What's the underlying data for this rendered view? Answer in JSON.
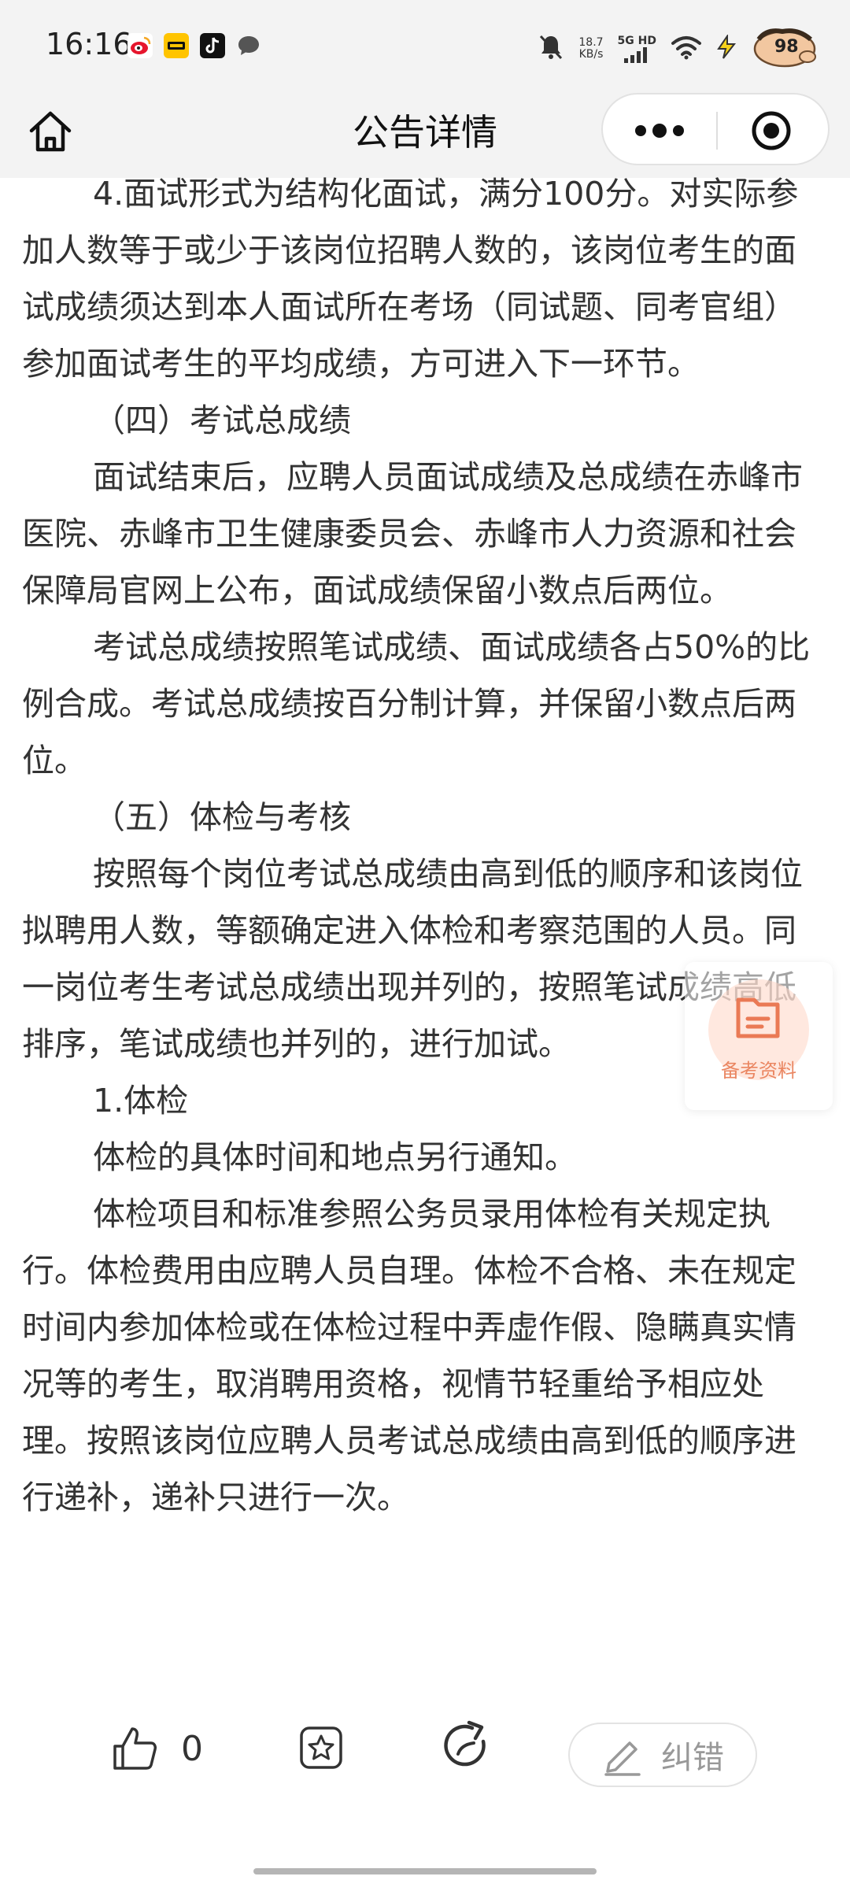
{
  "status_bar": {
    "time": "16:16",
    "net_speed_value": "18.7",
    "net_speed_unit": "KB/s",
    "network": "5G HD",
    "battery": "98"
  },
  "nav": {
    "title": "公告详情"
  },
  "article": {
    "paragraphs": [
      "4.面试形式为结构化面试，满分100分。对实际参加人数等于或少于该岗位招聘人数的，该岗位考生的面试成绩须达到本人面试所在考场（同试题、同考官组）参加面试考生的平均成绩，方可进入下一环节。",
      "（四）考试总成绩",
      "面试结束后，应聘人员面试成绩及总成绩在赤峰市医院、赤峰市卫生健康委员会、赤峰市人力资源和社会保障局官网上公布，面试成绩保留小数点后两位。",
      "考试总成绩按照笔试成绩、面试成绩各占50%的比例合成。考试总成绩按百分制计算，并保留小数点后两位。",
      "（五）体检与考核",
      "按照每个岗位考试总成绩由高到低的顺序和该岗位拟聘用人数，等额确定进入体检和考察范围的人员。同一岗位考生考试总成绩出现并列的，按照笔试成绩高低排序，笔试成绩也并列的，进行加试。",
      "1.体检",
      "体检的具体时间和地点另行通知。",
      "体检项目和标准参照公务员录用体检有关规定执行。体检费用由应聘人员自理。体检不合格、未在规定时间内参加体检或在体检过程中弄虚作假、隐瞒真实情况等的考生，取消聘用资格，视情节轻重给予相应处理。按照该岗位应聘人员考试总成绩由高到低的顺序进行递补，递补只进行一次。"
    ]
  },
  "float_button": {
    "label": "备考资料"
  },
  "toolbar": {
    "like_count": "0",
    "correct_label": "纠错"
  }
}
